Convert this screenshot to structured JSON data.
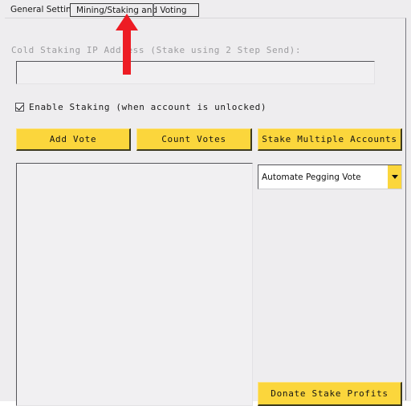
{
  "window": {
    "background_color": "#eeedef"
  },
  "tabs": [
    {
      "id": "general-settings",
      "label": "General Settings",
      "selected": false
    },
    {
      "id": "mining-staking-voting",
      "label": "Mining/Staking and Voting",
      "selected": true
    }
  ],
  "form": {
    "cold_staking_label": "Cold Staking IP Address (Stake using 2 Step Send):",
    "cold_staking_value": "",
    "cold_staking_placeholder": "",
    "enable_staking_label": "Enable Staking (when account is unlocked)",
    "enable_staking_checked": true
  },
  "buttons": {
    "add_vote": "Add Vote",
    "count_votes": "Count Votes",
    "stake_multiple_accounts": "Stake Multiple Accounts",
    "donate_stake_profits": "Donate Stake Profits"
  },
  "dropdown": {
    "selected": "Automate Pegging Vote",
    "arrow_icon": "chevron-down-icon"
  },
  "listbox": {
    "items": []
  },
  "annotation": {
    "type": "arrow-up",
    "color": "#ED1C24",
    "points_at": "mining-staking-voting-tab"
  },
  "colors": {
    "accent_yellow": "#fbd63c",
    "panel_gray": "#eeedef",
    "disabled_text": "#9c9c9f",
    "annotation_red": "#ED1C24"
  }
}
